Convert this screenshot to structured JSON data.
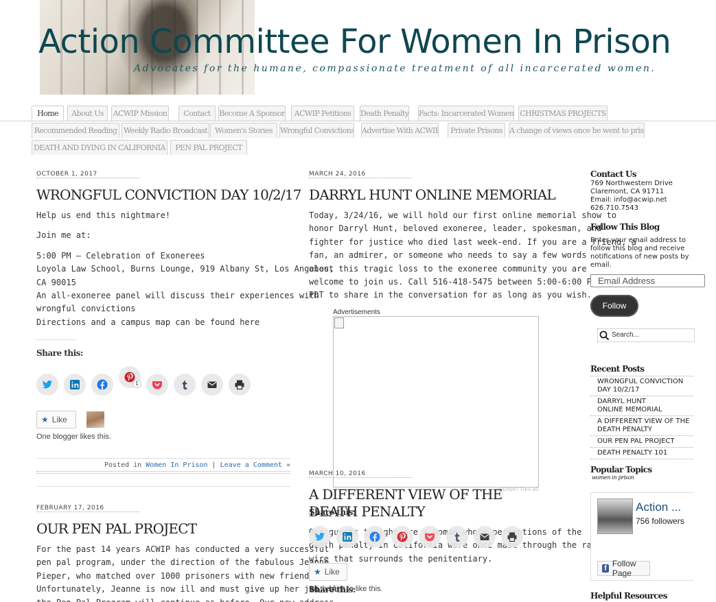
{
  "site": {
    "title": "Action Committee For Women In Prison",
    "tagline": "Advocates for the humane, compassionate treatment of all incarcerated women."
  },
  "nav": {
    "row1": [
      "Home",
      "About Us",
      "ACWIP Mission",
      "Contact",
      "Become A Sponsor",
      "ACWIP Petitions",
      "Death Penalty",
      "Facts: Incarcerated Women",
      "CHRISTMAS PROJECTS"
    ],
    "row2": [
      "Recommended Reading",
      "Weekly Radio Broadcast",
      "Women's Stories",
      "Wrongful Convictions",
      "Advertise With ACWIP",
      "Private Prisons",
      "A change of views once he went to prison"
    ],
    "row3": [
      "DEATH AND DYING IN CALIFORNIA",
      "PEN PAL PROJECT"
    ]
  },
  "posts": {
    "p1": {
      "date": "OCTOBER 1, 2017",
      "title": "WRONGFUL CONVICTION DAY 10/2/17",
      "lines": [
        "Help us end this nightmare!",
        "Join me at:",
        "5:00 PM – Celebration of Exonerees",
        "Loyola Law School, Burns Lounge, 919 Albany St, Los Angeles,",
        "CA 90015",
        "An all-exoneree panel will discuss their experiences with",
        "wrongful convictions",
        "Directions and a campus map can be found here"
      ],
      "share_title": "Share this:",
      "pinterest_count": "1",
      "like_label": "Like",
      "likes_text": "One blogger likes this.",
      "meta_prefix": "Posted in",
      "meta_category": "Women In Prison",
      "meta_sep": "|",
      "meta_comment": "Leave a Comment »"
    },
    "p2": {
      "date": "MARCH 24, 2016",
      "title": "DARRYL HUNT ONLINE MEMORIAL",
      "lines": [
        "Today, 3/24/16, we will hold our first online memorial show to",
        "honor Darryl Hunt, beloved exoneree, leader, spokesman, and",
        "fighter for justice who died last week-end. If you are a friend, a",
        "fan, an admirer, or someone who needs to say a few words",
        "about this tragic loss to the exoneree community you are",
        "welcome to join us. Call 516-418-5475 between 5:00-6:00 PM",
        "PDT to share in the conversation for as long as you wish."
      ]
    },
    "p3": {
      "date": "FEBRUARY 17, 2016",
      "title": "OUR PEN PAL PROJECT",
      "lines": [
        "For the past 14 years ACWIP has conducted a very successful",
        "pen pal program, under the direction of the fabulous Jeanne",
        "Pieper,  who matched over 1000 prisoners with new friends.",
        "Unfortunately, Jeanne is now ill and must give up her job, but",
        "the Pen Pal Program will continue as before. Our new address"
      ]
    },
    "p4": {
      "date": "MARCH 10, 2016",
      "title_line1": "A DIFFERENT VIEW OF THE",
      "title_line2": "DEATH PENALTY",
      "share_title": "Share this:",
      "lines": [
        "Our guests tonight are a woman whose perceptions of the",
        "death penalty in California were once made through the razor",
        "wire that surrounds the penitentiary."
      ],
      "like_label": "Like",
      "likes_text": "Be the first to like this.",
      "share_title_2": "Share this:"
    }
  },
  "ad": {
    "label": "Advertisements",
    "report": "REPORT THIS AD"
  },
  "sidebar": {
    "contact_title": "Contact Us",
    "contact_lines": [
      "769 Northwestern Drive",
      "Claremont, CA 91711",
      "Email: info@acwip.net",
      "626.710.7543"
    ],
    "follow_title": "Follow This Blog",
    "follow_lines": [
      "Enter your email address to",
      "follow this blog and receive",
      "notifications of new posts by",
      "email."
    ],
    "email_placeholder": "Email Address",
    "follow_button": "Follow",
    "search_placeholder": "Search...",
    "recent_title": "Recent Posts",
    "recent": [
      [
        "WRONGFUL CONVICTION",
        "DAY 10/2/17"
      ],
      [
        "DARRYL HUNT",
        "ONLINE MEMORIAL"
      ],
      [
        "A DIFFERENT VIEW OF THE",
        "DEATH PENALTY"
      ],
      [
        "OUR PEN PAL PROJECT"
      ],
      [
        "DEATH PENALTY 101"
      ]
    ],
    "topics_title": "Popular Topics",
    "topic": "women in prison",
    "fb_name": "Action ...",
    "fb_followers": "756 followers",
    "fb_follow_page": "Follow Page",
    "helpful_title": "Helpful Resources"
  },
  "colors": {
    "title": "#0e4750",
    "link": "#2b6bb0",
    "twitter": "#1da1f2",
    "linkedin": "#0077b5",
    "facebook": "#1877f2",
    "pinterest": "#cb2027",
    "pocket": "#ee4056",
    "tumblr": "#35465c"
  },
  "icons": [
    "twitter-icon",
    "linkedin-icon",
    "facebook-icon",
    "pinterest-icon",
    "pocket-icon",
    "tumblr-icon",
    "email-icon",
    "print-icon",
    "star-icon",
    "search-icon"
  ]
}
